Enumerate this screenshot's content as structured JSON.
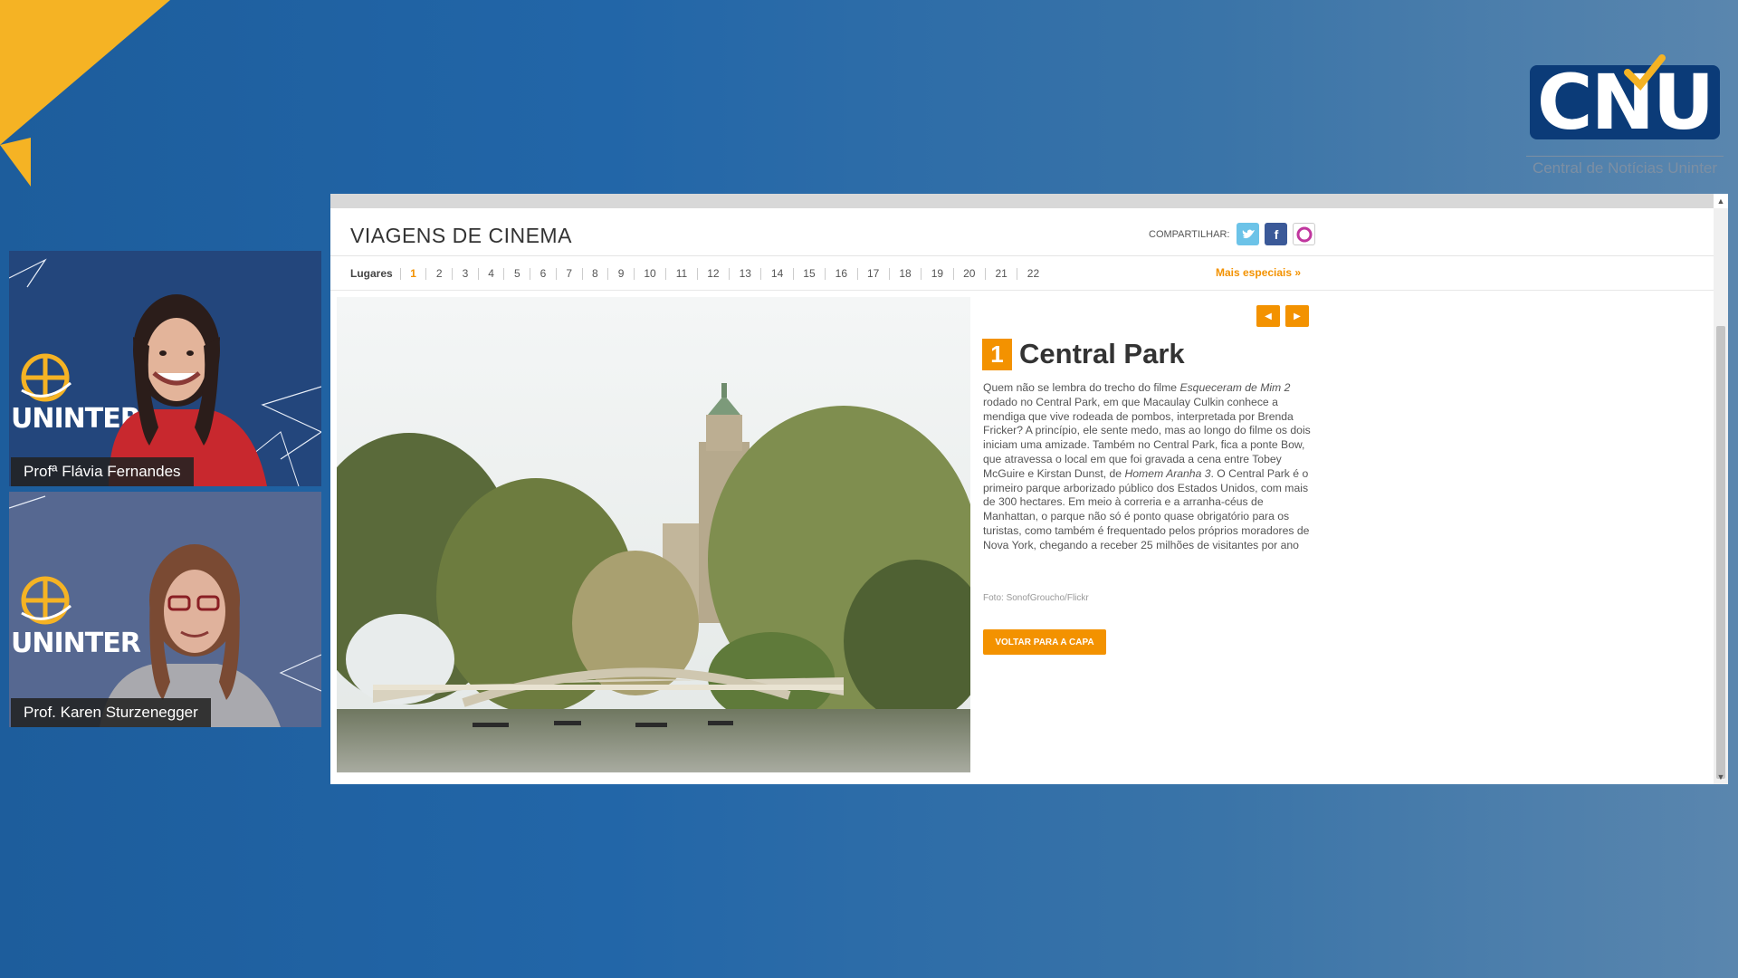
{
  "logo": {
    "text": "CNU",
    "subtitle": "Central de Notícias Uninter"
  },
  "participants": [
    {
      "name": "Profª Flávia Fernandes",
      "backdrop_text": "UNINTER"
    },
    {
      "name": "Prof. Karen Sturzenegger",
      "backdrop_text": "UNINTER"
    }
  ],
  "page": {
    "title": "VIAGENS DE CINEMA",
    "share_label": "COMPARTILHAR:",
    "nav_label": "Lugares",
    "nav_items": [
      "1",
      "2",
      "3",
      "4",
      "5",
      "6",
      "7",
      "8",
      "9",
      "10",
      "11",
      "12",
      "13",
      "14",
      "15",
      "16",
      "17",
      "18",
      "19",
      "20",
      "21",
      "22"
    ],
    "nav_active": "1",
    "nav_more": "Mais especiais »",
    "item_number": "1",
    "item_title": "Central Park",
    "item_text_parts": [
      "Quem não se lembra do trecho do filme ",
      "Esqueceram de Mim 2",
      " rodado no Central Park, em que Macaulay Culkin conhece a mendiga que vive rodeada de pombos, interpretada por Brenda Fricker? A princípio, ele sente medo, mas ao longo do filme os dois iniciam uma amizade. Também no Central Park, fica a ponte Bow, que atravessa o local em que foi gravada a cena entre Tobey McGuire e Kirstan Dunst, de ",
      "Homem Aranha 3",
      ". O Central Park é o primeiro parque arborizado público dos Estados Unidos, com mais de 300 hectares. Em meio à correria e a arranha-céus de Manhattan, o parque não só é ponto quase obrigatório para os turistas, como também é frequentado pelos próprios moradores de Nova York, chegando a receber 25 milhões de visitantes por ano"
    ],
    "photo_credit": "Foto: SonofGroucho/Flickr",
    "back_button": "VOLTAR PARA A CAPA"
  },
  "colors": {
    "accent": "#f39200",
    "logo_blue": "#0b3b78",
    "background": "#2266a8"
  },
  "icons": {
    "share": [
      "twitter-icon",
      "facebook-icon",
      "share-icon"
    ],
    "arrows": [
      "arrow-left-icon",
      "arrow-right-icon"
    ]
  }
}
